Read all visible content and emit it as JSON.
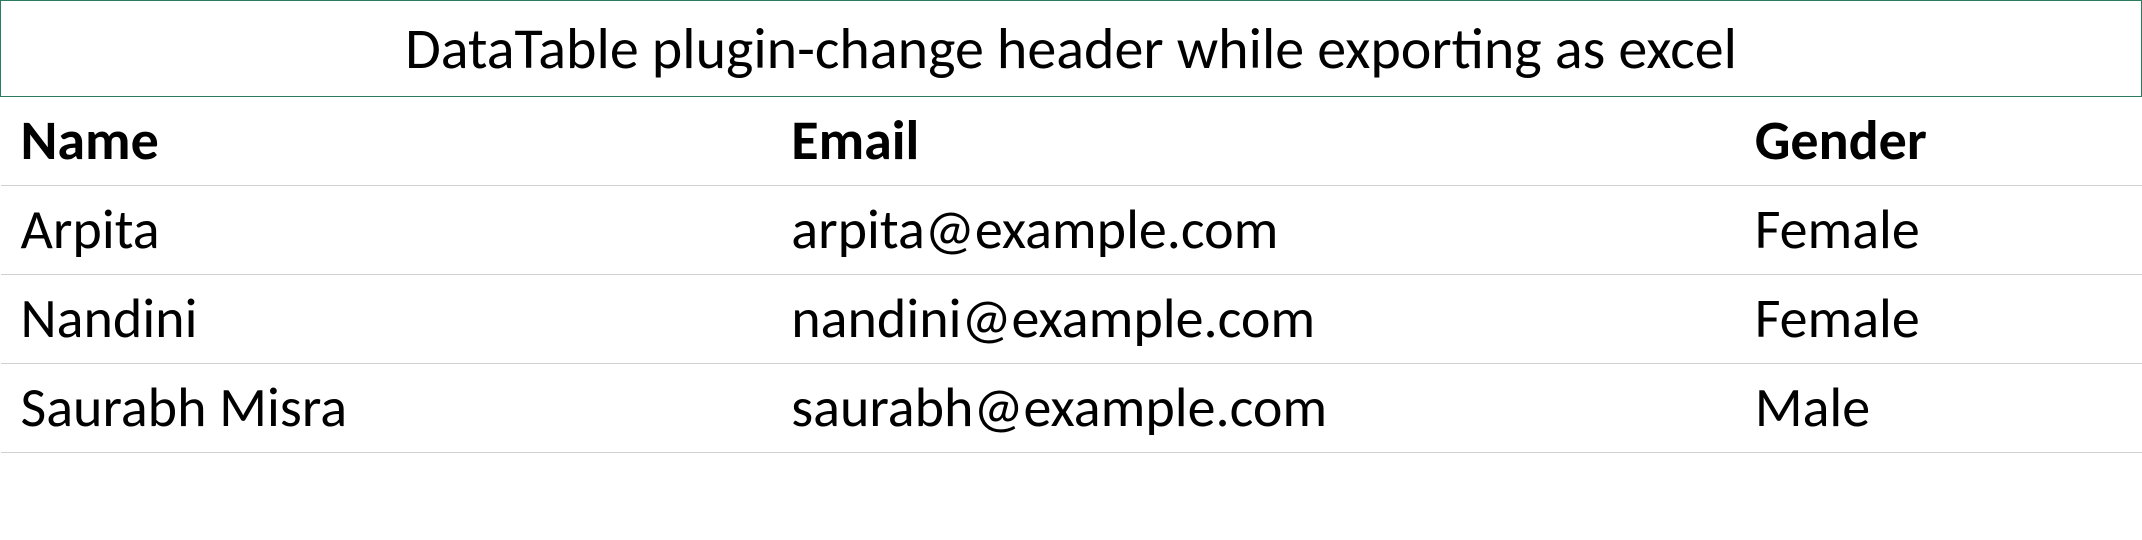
{
  "title": "DataTable plugin-change header while exporting as excel",
  "columns": {
    "name": "Name",
    "email": "Email",
    "gender": "Gender"
  },
  "rows": [
    {
      "name": "Arpita",
      "email": "arpita@example.com",
      "gender": "Female"
    },
    {
      "name": "Nandini",
      "email": "nandini@example.com",
      "gender": "Female"
    },
    {
      "name": "Saurabh Misra",
      "email": "saurabh@example.com",
      "gender": "Male"
    }
  ]
}
